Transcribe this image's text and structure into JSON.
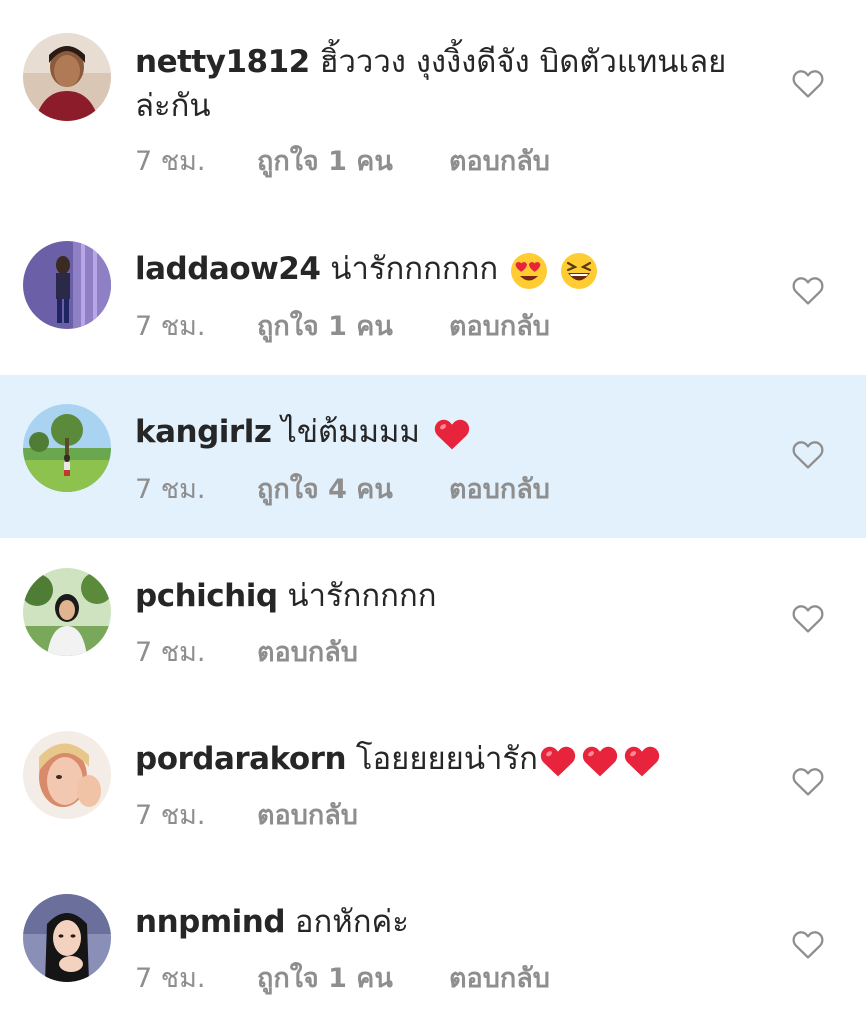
{
  "comments": [
    {
      "username": "netty1812",
      "text": "ฮิ้วววง งุงงิ้งดีจัง บิดตัวแทนเลยล่ะกัน",
      "time": "7 ชม.",
      "likes": "ถูกใจ 1 คน",
      "reply": "ตอบกลับ",
      "highlighted": false,
      "emojis": []
    },
    {
      "username": "laddaow24",
      "text": "น่ารักกกกกก",
      "time": "7 ชม.",
      "likes": "ถูกใจ 1 คน",
      "reply": "ตอบกลับ",
      "highlighted": false,
      "emojis": [
        "heart-eyes-emoji",
        "laughing-emoji"
      ]
    },
    {
      "username": "kangirlz",
      "text": "ไข่ต้มมมม",
      "time": "7 ชม.",
      "likes": "ถูกใจ 4 คน",
      "reply": "ตอบกลับ",
      "highlighted": true,
      "emojis": [
        "red-heart-emoji"
      ]
    },
    {
      "username": "pchichiq",
      "text": "น่ารักกกกก",
      "time": "7 ชม.",
      "likes": "",
      "reply": "ตอบกลับ",
      "highlighted": false,
      "emojis": []
    },
    {
      "username": "pordarakorn",
      "text": "โอยยยยน่ารัก",
      "time": "7 ชม.",
      "likes": "",
      "reply": "ตอบกลับ",
      "highlighted": false,
      "emojis": [
        "red-heart-emoji",
        "red-heart-emoji",
        "red-heart-emoji"
      ]
    },
    {
      "username": "nnpmind",
      "text": "อกหักค่ะ",
      "time": "7 ชม.",
      "likes": "ถูกใจ 1 คน",
      "reply": "ตอบกลับ",
      "highlighted": false,
      "emojis": []
    }
  ],
  "colors": {
    "highlight_bg": "#e3f1fd",
    "meta_text": "#8e8e8e",
    "primary_text": "#262626",
    "heart_outline": "#8e8e8e"
  }
}
